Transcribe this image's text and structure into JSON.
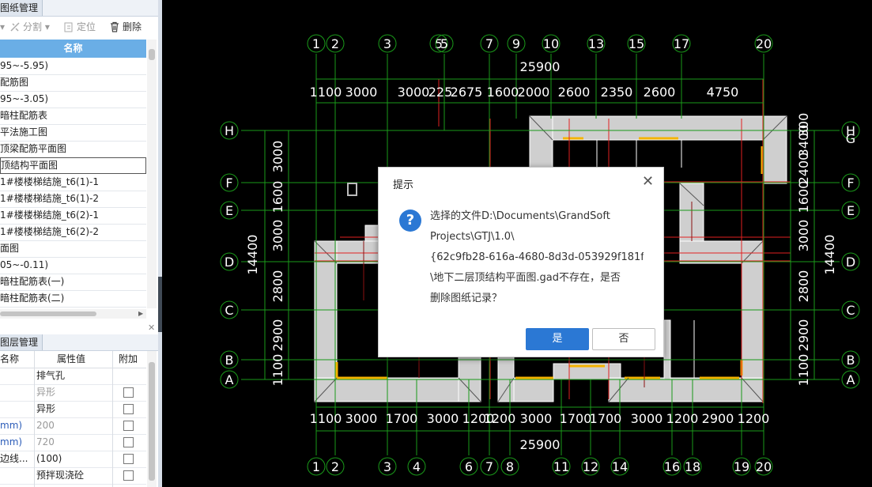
{
  "left_panel": {
    "drawing_tab": "图纸管理",
    "toolbar": {
      "split": "分割",
      "locate": "定位",
      "delete": "删除"
    },
    "column_header": "名称",
    "rows": [
      "95~-5.95)",
      "配筋图",
      "95~-3.05)",
      "暗柱配筋表",
      "平法施工图",
      "顶梁配筋平面图",
      "顶结构平面图",
      "1#楼楼梯结施_t6(1)-1",
      "1#楼楼梯结施_t6(1)-2",
      "1#楼楼梯结施_t6(2)-1",
      "1#楼楼梯结施_t6(2)-2",
      "面图",
      "05~-0.11)",
      "暗柱配筋表(一)",
      "暗柱配筋表(二)"
    ],
    "layer_tab": "图层管理",
    "prop_headers": {
      "name": "名称",
      "value": "属性值",
      "extra": "附加"
    },
    "props": [
      {
        "name": "",
        "value": "排气孔",
        "muted": false,
        "checkbox": false
      },
      {
        "name": "",
        "value": "异形",
        "muted": true,
        "checkbox": true
      },
      {
        "name": "",
        "value": "异形",
        "muted": false,
        "checkbox": true
      },
      {
        "name": "mm)",
        "value": "200",
        "muted": true,
        "checkbox": true
      },
      {
        "name": "mm)",
        "value": "720",
        "muted": true,
        "checkbox": true
      },
      {
        "name": "边线...",
        "value": "(100)",
        "muted": false,
        "checkbox": true
      },
      {
        "name": "",
        "value": "预拌现浇砼",
        "muted": false,
        "checkbox": true
      }
    ]
  },
  "cad": {
    "top_axes": [
      "1",
      "2",
      "3",
      "5",
      "5",
      "7",
      "9",
      "10",
      "13",
      "15",
      "17",
      "20"
    ],
    "bottom_axes": [
      "1",
      "2",
      "3",
      "4",
      "6",
      "7",
      "8",
      "11",
      "12",
      "14",
      "16",
      "18",
      "19",
      "20"
    ],
    "row_axes": [
      "H",
      "F",
      "E",
      "D",
      "C",
      "B",
      "A"
    ],
    "right_extra_axis": "G",
    "total_dim": "25900",
    "top_dims": [
      "1100",
      "3000",
      "3000",
      "225",
      "2675",
      "1600",
      "2000",
      "2600",
      "2350",
      "2600",
      "4750"
    ],
    "bottom_dims": [
      "1100",
      "3000",
      "1700",
      "3000",
      "1200",
      "1200",
      "3000",
      "1700",
      "1700",
      "3000",
      "1200",
      "2900",
      "1200"
    ],
    "left_dims": [
      "3000",
      "1600",
      "3000",
      "2800",
      "2900",
      "1100"
    ],
    "right_dims": [
      "3400",
      "2400",
      "1600",
      "3000",
      "2800",
      "2900",
      "1100"
    ],
    "left_total": "14400",
    "right_total": "14400",
    "right_top_small": "300"
  },
  "dialog": {
    "title": "提示",
    "message_lines": [
      "选择的文件D:\\Documents\\GrandSoft",
      "Projects\\GTJ\\1.0\\",
      "{62c9fb28-616a-4680-8d3d-053929f181f",
      "\\地下二层顶结构平面图.gad不存在，是否",
      "删除图纸记录？"
    ],
    "yes": "是",
    "no": "否",
    "icon_glyph": "?",
    "close_glyph": "✕"
  }
}
